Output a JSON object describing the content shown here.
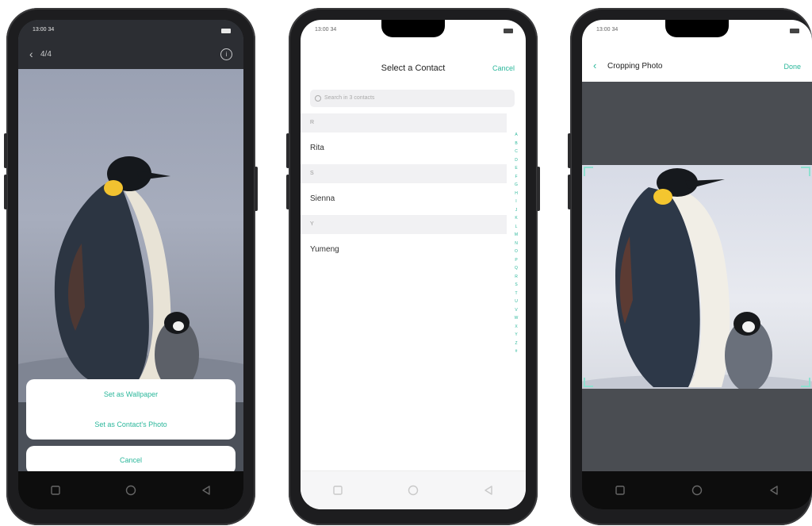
{
  "phone1": {
    "status_time": "13:00 34",
    "counter": "4/4",
    "actions": [
      "Set as Wallpaper",
      "Set as Contact's Photo"
    ],
    "cancel_label": "Cancel"
  },
  "phone2": {
    "status_time": "13:00 34",
    "title": "Select a Contact",
    "cancel_label": "Cancel",
    "search_placeholder": "Search in 3 contacts",
    "sections": [
      {
        "header": "R",
        "contact": "Rita"
      },
      {
        "header": "S",
        "contact": "Sienna"
      },
      {
        "header": "Y",
        "contact": "Yumeng"
      }
    ],
    "index": [
      "A",
      "B",
      "C",
      "D",
      "E",
      "F",
      "G",
      "H",
      "I",
      "J",
      "K",
      "L",
      "M",
      "N",
      "O",
      "P",
      "Q",
      "R",
      "S",
      "T",
      "U",
      "V",
      "W",
      "X",
      "Y",
      "Z",
      "#"
    ]
  },
  "phone3": {
    "status_time": "13:00 34",
    "title": "Cropping Photo",
    "done_label": "Done"
  },
  "colors": {
    "accent": "#2bb79b",
    "frame": "#1d1d1f"
  },
  "icons": [
    "back-icon",
    "info-icon",
    "battery-icon",
    "search-icon",
    "nav-square-icon",
    "nav-circle-icon",
    "nav-back-icon"
  ]
}
